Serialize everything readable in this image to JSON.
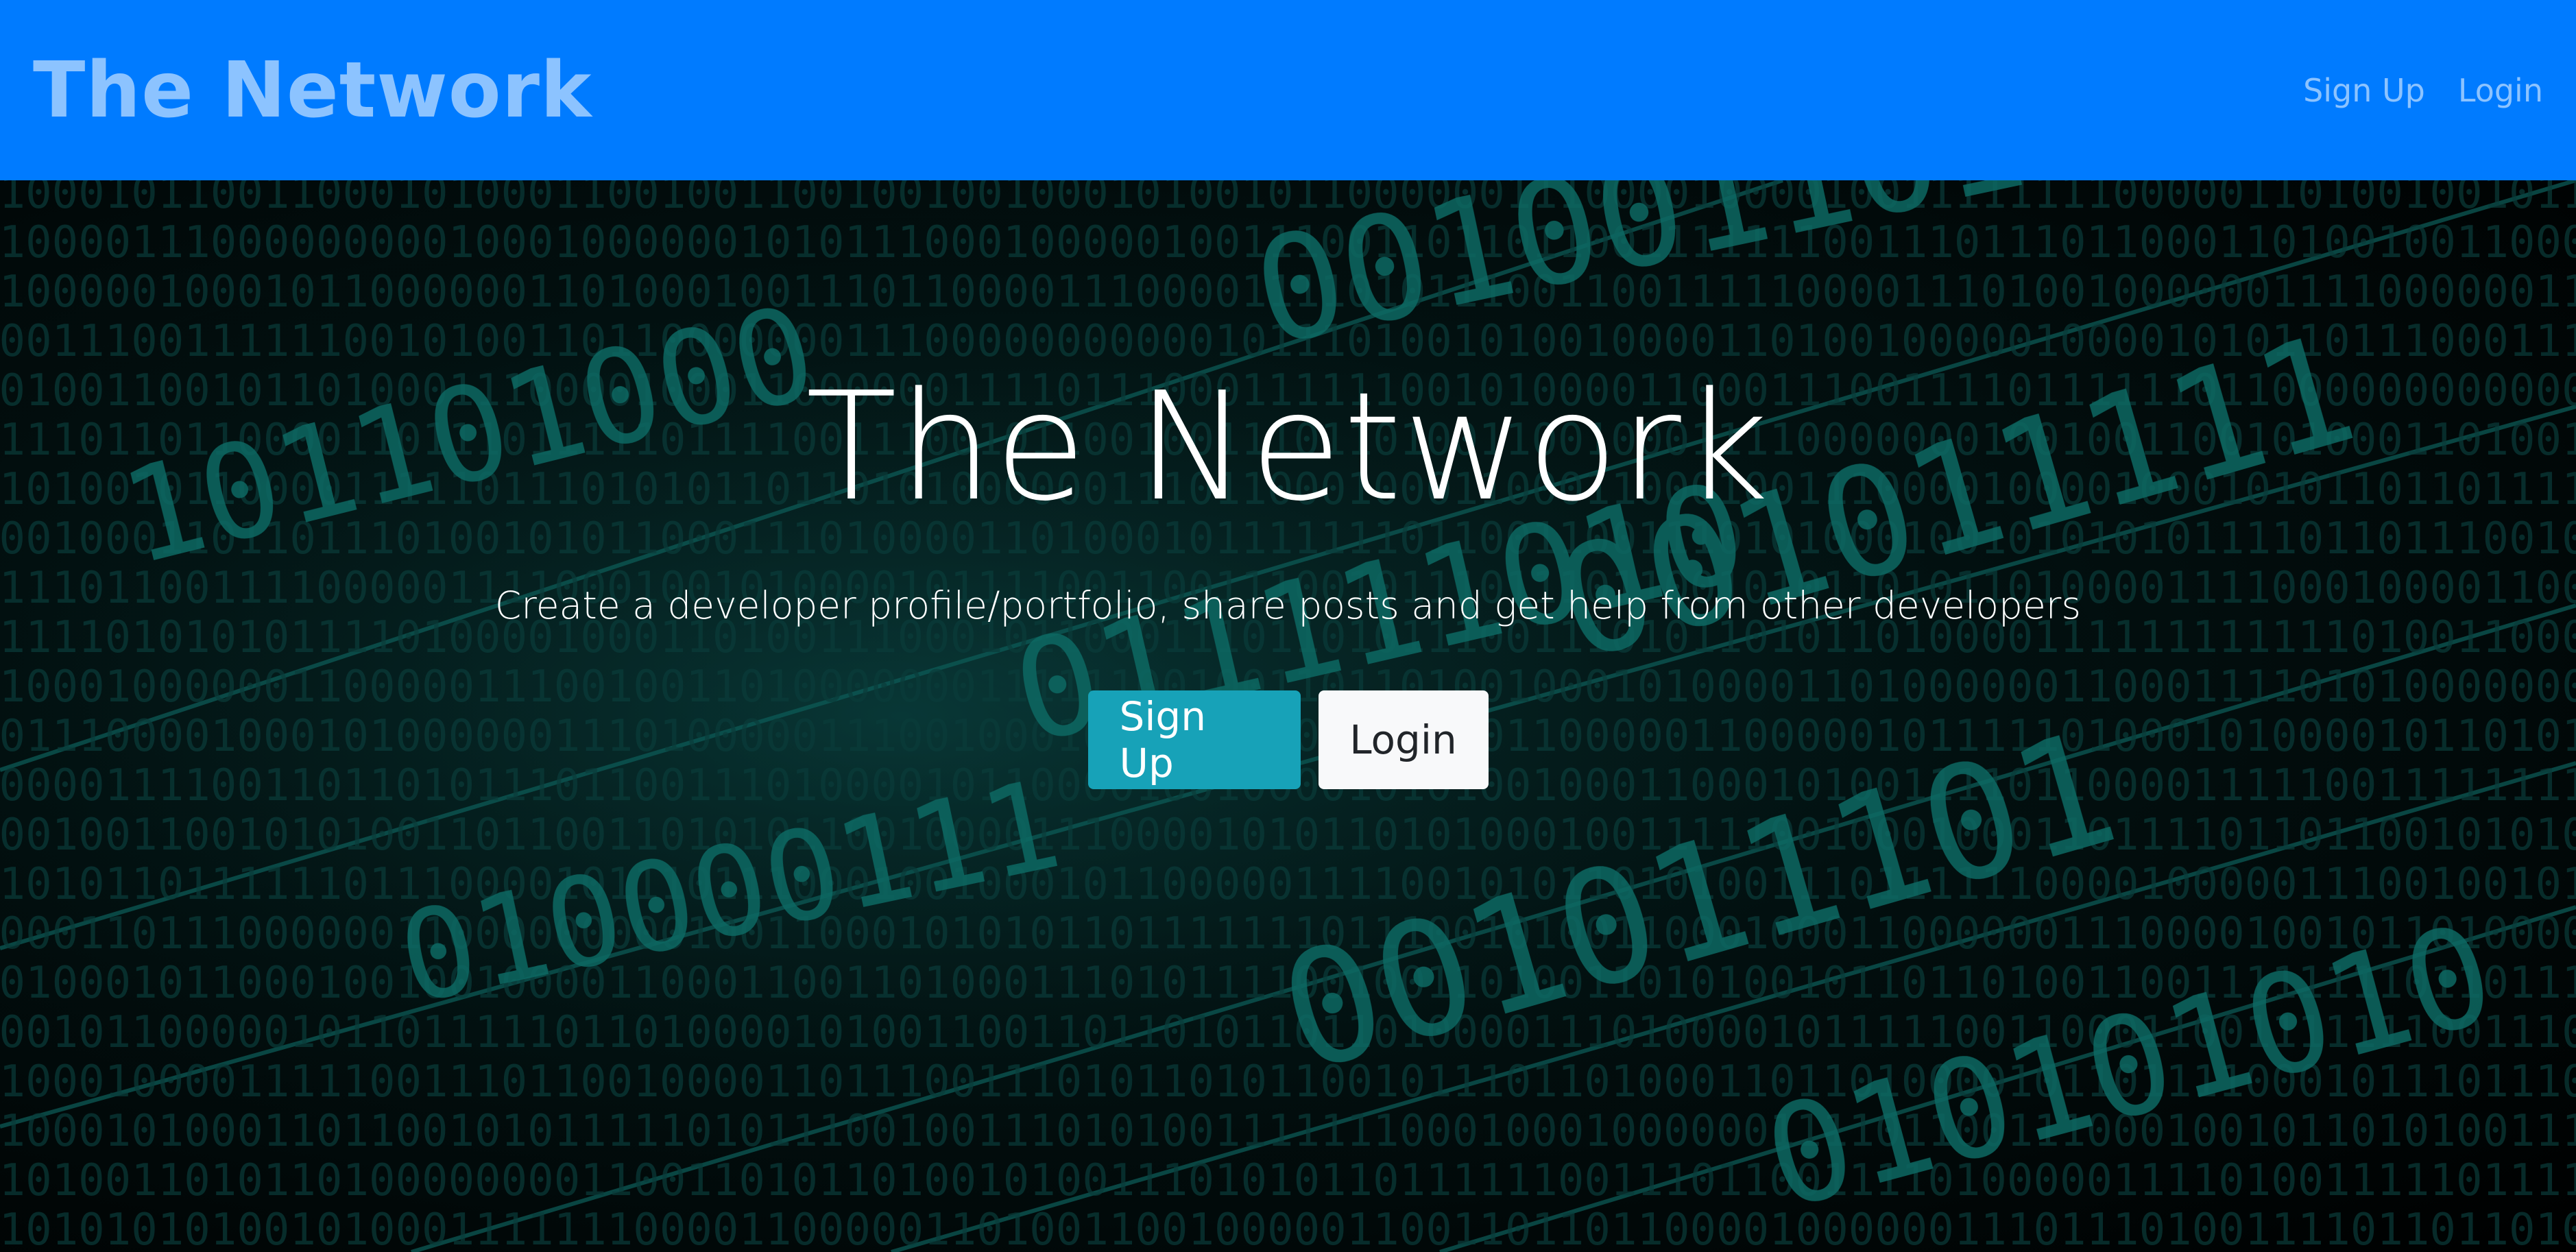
{
  "navbar": {
    "brand": "The Network",
    "links": [
      {
        "label": "Sign Up"
      },
      {
        "label": "Login"
      }
    ],
    "background_color": "#007bff"
  },
  "hero": {
    "title": "The Network",
    "subtitle": "Create a developer profile/portfolio, share posts and get help from other developers",
    "buttons": {
      "signup_label": "Sign Up",
      "login_label": "Login"
    },
    "background_description": "binary-code-image",
    "accent_color": "#0fb5a8",
    "signup_color": "#17a2b8",
    "login_color": "#f8f9fa"
  }
}
